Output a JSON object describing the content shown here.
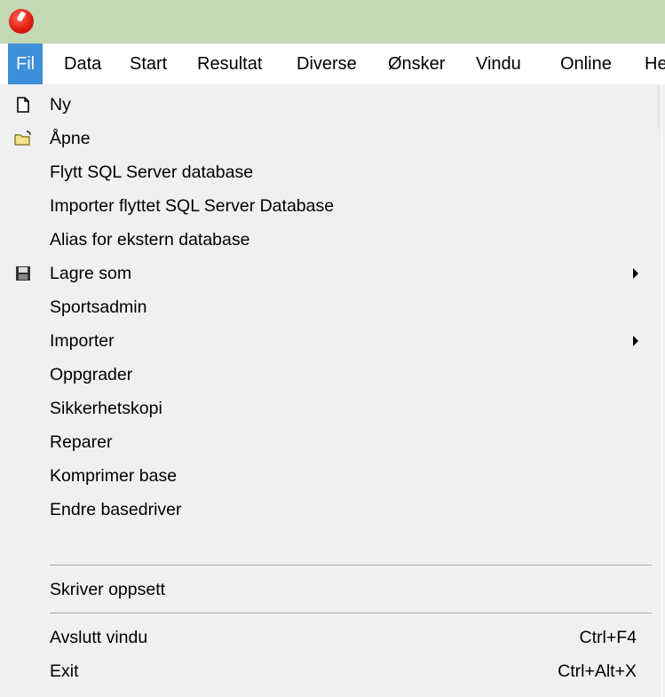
{
  "menubar": {
    "items": [
      "Fil",
      "Data",
      "Start",
      "Resultat",
      "Diverse",
      "Ønsker",
      "Vindu",
      "Online",
      "He"
    ]
  },
  "menu": {
    "items": [
      {
        "label": "Ny",
        "icon": "new-file-icon"
      },
      {
        "label": "Åpne",
        "icon": "open-folder-icon"
      },
      {
        "label": "Flytt SQL Server database"
      },
      {
        "label": "Importer flyttet SQL Server Database"
      },
      {
        "label": "Alias for ekstern database"
      },
      {
        "label": "Lagre som",
        "icon": "floppy-disk-icon",
        "submenu": true
      },
      {
        "label": "Sportsadmin"
      },
      {
        "label": "Importer",
        "submenu": true
      },
      {
        "label": "Oppgrader"
      },
      {
        "label": "Sikkerhetskopi"
      },
      {
        "label": "Reparer"
      },
      {
        "label": "Komprimer base"
      },
      {
        "label": "Endre basedriver"
      },
      {
        "label": "Skriver oppsett"
      },
      {
        "label": "Avslutt vindu",
        "shortcut": "Ctrl+F4"
      },
      {
        "label": "Exit",
        "shortcut": "Ctrl+Alt+X"
      }
    ]
  },
  "colors": {
    "titlebar": "#c2d9b4",
    "menu_highlight": "#3c8fd8",
    "menu_background": "#f0f0f0"
  }
}
